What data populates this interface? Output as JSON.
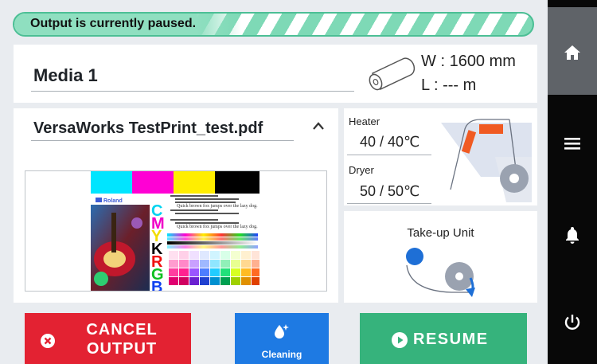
{
  "status": {
    "message": "Output is currently paused.",
    "color": "#4cbf95"
  },
  "media": {
    "name": "Media 1",
    "width_label": "W",
    "width_value": ": 1600 mm",
    "length_label": "L",
    "length_value": ": --- m",
    "roll_icon": "media-roll-icon"
  },
  "job": {
    "file_name": "VersaWorks TestPrint_test.pdf",
    "collapse_icon": "chevron-up-icon",
    "preview_icon": "print-preview-image"
  },
  "heater": {
    "heater_label": "Heater",
    "heater_value": "40 / 40℃",
    "dryer_label": "Dryer",
    "dryer_value": "50 / 50℃",
    "accent": "#f05a22"
  },
  "takeup": {
    "label": "Take-up Unit",
    "accent": "#1e6fd6"
  },
  "buttons": {
    "cancel_line1": "CANCEL",
    "cancel_line2": "OUTPUT",
    "cleaning": "Cleaning",
    "resume": "RESUME",
    "cancel_color": "#e32232",
    "cleaning_color": "#1e7ae3",
    "resume_color": "#36b37c"
  },
  "sidebar": {
    "items": [
      {
        "icon": "home-icon",
        "active": true
      },
      {
        "icon": "menu-icon",
        "active": false
      },
      {
        "icon": "bell-icon",
        "active": false
      },
      {
        "icon": "power-icon",
        "active": false
      }
    ]
  },
  "preview": {
    "brand": "Roland",
    "letters": [
      "C",
      "M",
      "Y",
      "K",
      "R",
      "G",
      "B"
    ],
    "sample_text": "Quick brown fox jumps over the lazy dog."
  }
}
